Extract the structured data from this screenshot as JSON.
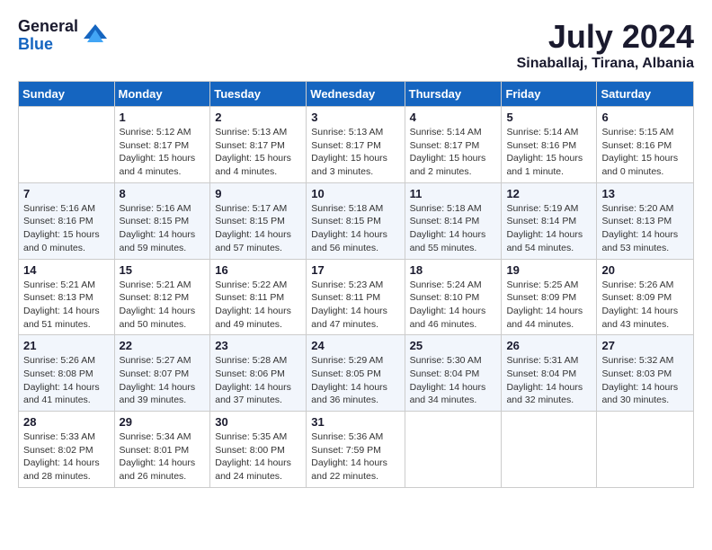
{
  "header": {
    "logo_general": "General",
    "logo_blue": "Blue",
    "title": "July 2024",
    "location": "Sinaballaj, Tirana, Albania"
  },
  "columns": [
    "Sunday",
    "Monday",
    "Tuesday",
    "Wednesday",
    "Thursday",
    "Friday",
    "Saturday"
  ],
  "weeks": [
    [
      {
        "day": "",
        "sunrise": "",
        "sunset": "",
        "daylight": ""
      },
      {
        "day": "1",
        "sunrise": "Sunrise: 5:12 AM",
        "sunset": "Sunset: 8:17 PM",
        "daylight": "Daylight: 15 hours and 4 minutes."
      },
      {
        "day": "2",
        "sunrise": "Sunrise: 5:13 AM",
        "sunset": "Sunset: 8:17 PM",
        "daylight": "Daylight: 15 hours and 4 minutes."
      },
      {
        "day": "3",
        "sunrise": "Sunrise: 5:13 AM",
        "sunset": "Sunset: 8:17 PM",
        "daylight": "Daylight: 15 hours and 3 minutes."
      },
      {
        "day": "4",
        "sunrise": "Sunrise: 5:14 AM",
        "sunset": "Sunset: 8:17 PM",
        "daylight": "Daylight: 15 hours and 2 minutes."
      },
      {
        "day": "5",
        "sunrise": "Sunrise: 5:14 AM",
        "sunset": "Sunset: 8:16 PM",
        "daylight": "Daylight: 15 hours and 1 minute."
      },
      {
        "day": "6",
        "sunrise": "Sunrise: 5:15 AM",
        "sunset": "Sunset: 8:16 PM",
        "daylight": "Daylight: 15 hours and 0 minutes."
      }
    ],
    [
      {
        "day": "7",
        "sunrise": "Sunrise: 5:16 AM",
        "sunset": "Sunset: 8:16 PM",
        "daylight": "Daylight: 15 hours and 0 minutes."
      },
      {
        "day": "8",
        "sunrise": "Sunrise: 5:16 AM",
        "sunset": "Sunset: 8:15 PM",
        "daylight": "Daylight: 14 hours and 59 minutes."
      },
      {
        "day": "9",
        "sunrise": "Sunrise: 5:17 AM",
        "sunset": "Sunset: 8:15 PM",
        "daylight": "Daylight: 14 hours and 57 minutes."
      },
      {
        "day": "10",
        "sunrise": "Sunrise: 5:18 AM",
        "sunset": "Sunset: 8:15 PM",
        "daylight": "Daylight: 14 hours and 56 minutes."
      },
      {
        "day": "11",
        "sunrise": "Sunrise: 5:18 AM",
        "sunset": "Sunset: 8:14 PM",
        "daylight": "Daylight: 14 hours and 55 minutes."
      },
      {
        "day": "12",
        "sunrise": "Sunrise: 5:19 AM",
        "sunset": "Sunset: 8:14 PM",
        "daylight": "Daylight: 14 hours and 54 minutes."
      },
      {
        "day": "13",
        "sunrise": "Sunrise: 5:20 AM",
        "sunset": "Sunset: 8:13 PM",
        "daylight": "Daylight: 14 hours and 53 minutes."
      }
    ],
    [
      {
        "day": "14",
        "sunrise": "Sunrise: 5:21 AM",
        "sunset": "Sunset: 8:13 PM",
        "daylight": "Daylight: 14 hours and 51 minutes."
      },
      {
        "day": "15",
        "sunrise": "Sunrise: 5:21 AM",
        "sunset": "Sunset: 8:12 PM",
        "daylight": "Daylight: 14 hours and 50 minutes."
      },
      {
        "day": "16",
        "sunrise": "Sunrise: 5:22 AM",
        "sunset": "Sunset: 8:11 PM",
        "daylight": "Daylight: 14 hours and 49 minutes."
      },
      {
        "day": "17",
        "sunrise": "Sunrise: 5:23 AM",
        "sunset": "Sunset: 8:11 PM",
        "daylight": "Daylight: 14 hours and 47 minutes."
      },
      {
        "day": "18",
        "sunrise": "Sunrise: 5:24 AM",
        "sunset": "Sunset: 8:10 PM",
        "daylight": "Daylight: 14 hours and 46 minutes."
      },
      {
        "day": "19",
        "sunrise": "Sunrise: 5:25 AM",
        "sunset": "Sunset: 8:09 PM",
        "daylight": "Daylight: 14 hours and 44 minutes."
      },
      {
        "day": "20",
        "sunrise": "Sunrise: 5:26 AM",
        "sunset": "Sunset: 8:09 PM",
        "daylight": "Daylight: 14 hours and 43 minutes."
      }
    ],
    [
      {
        "day": "21",
        "sunrise": "Sunrise: 5:26 AM",
        "sunset": "Sunset: 8:08 PM",
        "daylight": "Daylight: 14 hours and 41 minutes."
      },
      {
        "day": "22",
        "sunrise": "Sunrise: 5:27 AM",
        "sunset": "Sunset: 8:07 PM",
        "daylight": "Daylight: 14 hours and 39 minutes."
      },
      {
        "day": "23",
        "sunrise": "Sunrise: 5:28 AM",
        "sunset": "Sunset: 8:06 PM",
        "daylight": "Daylight: 14 hours and 37 minutes."
      },
      {
        "day": "24",
        "sunrise": "Sunrise: 5:29 AM",
        "sunset": "Sunset: 8:05 PM",
        "daylight": "Daylight: 14 hours and 36 minutes."
      },
      {
        "day": "25",
        "sunrise": "Sunrise: 5:30 AM",
        "sunset": "Sunset: 8:04 PM",
        "daylight": "Daylight: 14 hours and 34 minutes."
      },
      {
        "day": "26",
        "sunrise": "Sunrise: 5:31 AM",
        "sunset": "Sunset: 8:04 PM",
        "daylight": "Daylight: 14 hours and 32 minutes."
      },
      {
        "day": "27",
        "sunrise": "Sunrise: 5:32 AM",
        "sunset": "Sunset: 8:03 PM",
        "daylight": "Daylight: 14 hours and 30 minutes."
      }
    ],
    [
      {
        "day": "28",
        "sunrise": "Sunrise: 5:33 AM",
        "sunset": "Sunset: 8:02 PM",
        "daylight": "Daylight: 14 hours and 28 minutes."
      },
      {
        "day": "29",
        "sunrise": "Sunrise: 5:34 AM",
        "sunset": "Sunset: 8:01 PM",
        "daylight": "Daylight: 14 hours and 26 minutes."
      },
      {
        "day": "30",
        "sunrise": "Sunrise: 5:35 AM",
        "sunset": "Sunset: 8:00 PM",
        "daylight": "Daylight: 14 hours and 24 minutes."
      },
      {
        "day": "31",
        "sunrise": "Sunrise: 5:36 AM",
        "sunset": "Sunset: 7:59 PM",
        "daylight": "Daylight: 14 hours and 22 minutes."
      },
      {
        "day": "",
        "sunrise": "",
        "sunset": "",
        "daylight": ""
      },
      {
        "day": "",
        "sunrise": "",
        "sunset": "",
        "daylight": ""
      },
      {
        "day": "",
        "sunrise": "",
        "sunset": "",
        "daylight": ""
      }
    ]
  ]
}
